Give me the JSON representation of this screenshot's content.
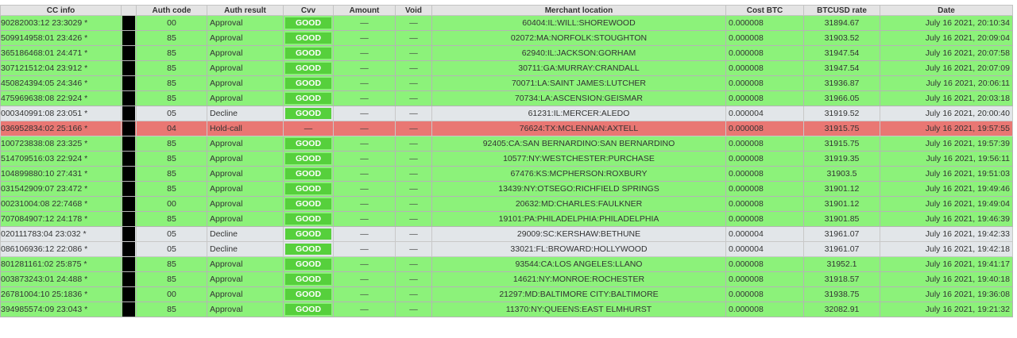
{
  "headers": {
    "cc_info": "CC info",
    "mask": "",
    "auth_code": "Auth code",
    "auth_result": "Auth result",
    "cvv": "Cvv",
    "amount": "Amount",
    "void": "Void",
    "merchant_location": "Merchant location",
    "cost_btc": "Cost BTC",
    "btcusd_rate": "BTCUSD rate",
    "date": "Date"
  },
  "status_colors": {
    "approval": "#8cf27a",
    "decline": "#e2e6e9",
    "holdcall": "#e97773",
    "good_badge": "#56d03c"
  },
  "rows": [
    {
      "status": "approval",
      "cc": "90282003:12 23:3029 *",
      "auth_code": "00",
      "auth_result": "Approval",
      "cvv": "GOOD",
      "amount": "—",
      "void": "—",
      "location": "60404:IL:WILL:SHOREWOOD",
      "cost": "0.000008",
      "rate": "31894.67",
      "date": "July 16 2021, 20:10:34"
    },
    {
      "status": "approval",
      "cc": "509914958:01 23:426 *",
      "auth_code": "85",
      "auth_result": "Approval",
      "cvv": "GOOD",
      "amount": "—",
      "void": "—",
      "location": "02072:MA:NORFOLK:STOUGHTON",
      "cost": "0.000008",
      "rate": "31903.52",
      "date": "July 16 2021, 20:09:04"
    },
    {
      "status": "approval",
      "cc": "365186468:01 24:471 *",
      "auth_code": "85",
      "auth_result": "Approval",
      "cvv": "GOOD",
      "amount": "—",
      "void": "—",
      "location": "62940:IL:JACKSON:GORHAM",
      "cost": "0.000008",
      "rate": "31947.54",
      "date": "July 16 2021, 20:07:58"
    },
    {
      "status": "approval",
      "cc": "307121512:04 23:912 *",
      "auth_code": "85",
      "auth_result": "Approval",
      "cvv": "GOOD",
      "amount": "—",
      "void": "—",
      "location": "30711:GA:MURRAY:CRANDALL",
      "cost": "0.000008",
      "rate": "31947.54",
      "date": "July 16 2021, 20:07:09"
    },
    {
      "status": "approval",
      "cc": "450824394:05 24:346 *",
      "auth_code": "85",
      "auth_result": "Approval",
      "cvv": "GOOD",
      "amount": "—",
      "void": "—",
      "location": "70071:LA:SAINT JAMES:LUTCHER",
      "cost": "0.000008",
      "rate": "31936.87",
      "date": "July 16 2021, 20:06:11"
    },
    {
      "status": "approval",
      "cc": "475969638:08 22:924 *",
      "auth_code": "85",
      "auth_result": "Approval",
      "cvv": "GOOD",
      "amount": "—",
      "void": "—",
      "location": "70734:LA:ASCENSION:GEISMAR",
      "cost": "0.000008",
      "rate": "31966.05",
      "date": "July 16 2021, 20:03:18"
    },
    {
      "status": "decline",
      "cc": "000340991:08 23:051 *",
      "auth_code": "05",
      "auth_result": "Decline",
      "cvv": "GOOD",
      "amount": "—",
      "void": "—",
      "location": "61231:IL:MERCER:ALEDO",
      "cost": "0.000004",
      "rate": "31919.52",
      "date": "July 16 2021, 20:00:40"
    },
    {
      "status": "holdcall",
      "cc": "036952834:02 25:166 *",
      "auth_code": "04",
      "auth_result": "Hold-call",
      "cvv": "—",
      "amount": "—",
      "void": "—",
      "location": "76624:TX:MCLENNAN:AXTELL",
      "cost": "0.000008",
      "rate": "31915.75",
      "date": "July 16 2021, 19:57:55"
    },
    {
      "status": "approval",
      "cc": "100723838:08 23:325 *",
      "auth_code": "85",
      "auth_result": "Approval",
      "cvv": "GOOD",
      "amount": "—",
      "void": "—",
      "location": "92405:CA:SAN BERNARDINO:SAN BERNARDINO",
      "cost": "0.000008",
      "rate": "31915.75",
      "date": "July 16 2021, 19:57:39"
    },
    {
      "status": "approval",
      "cc": "514709516:03 22:924 *",
      "auth_code": "85",
      "auth_result": "Approval",
      "cvv": "GOOD",
      "amount": "—",
      "void": "—",
      "location": "10577:NY:WESTCHESTER:PURCHASE",
      "cost": "0.000008",
      "rate": "31919.35",
      "date": "July 16 2021, 19:56:11"
    },
    {
      "status": "approval",
      "cc": "104899880:10 27:431 *",
      "auth_code": "85",
      "auth_result": "Approval",
      "cvv": "GOOD",
      "amount": "—",
      "void": "—",
      "location": "67476:KS:MCPHERSON:ROXBURY",
      "cost": "0.000008",
      "rate": "31903.5",
      "date": "July 16 2021, 19:51:03"
    },
    {
      "status": "approval",
      "cc": "031542909:07 23:472 *",
      "auth_code": "85",
      "auth_result": "Approval",
      "cvv": "GOOD",
      "amount": "—",
      "void": "—",
      "location": "13439:NY:OTSEGO:RICHFIELD SPRINGS",
      "cost": "0.000008",
      "rate": "31901.12",
      "date": "July 16 2021, 19:49:46"
    },
    {
      "status": "approval",
      "cc": "00231004:08 22:7468 *",
      "auth_code": "00",
      "auth_result": "Approval",
      "cvv": "GOOD",
      "amount": "—",
      "void": "—",
      "location": "20632:MD:CHARLES:FAULKNER",
      "cost": "0.000008",
      "rate": "31901.12",
      "date": "July 16 2021, 19:49:04"
    },
    {
      "status": "approval",
      "cc": "707084907:12 24:178 *",
      "auth_code": "85",
      "auth_result": "Approval",
      "cvv": "GOOD",
      "amount": "—",
      "void": "—",
      "location": "19101:PA:PHILADELPHIA:PHILADELPHIA",
      "cost": "0.000008",
      "rate": "31901.85",
      "date": "July 16 2021, 19:46:39"
    },
    {
      "status": "decline",
      "cc": "020111783:04 23:032 *",
      "auth_code": "05",
      "auth_result": "Decline",
      "cvv": "GOOD",
      "amount": "—",
      "void": "—",
      "location": "29009:SC:KERSHAW:BETHUNE",
      "cost": "0.000004",
      "rate": "31961.07",
      "date": "July 16 2021, 19:42:33"
    },
    {
      "status": "decline",
      "cc": "086106936:12 22:086 *",
      "auth_code": "05",
      "auth_result": "Decline",
      "cvv": "GOOD",
      "amount": "—",
      "void": "—",
      "location": "33021:FL:BROWARD:HOLLYWOOD",
      "cost": "0.000004",
      "rate": "31961.07",
      "date": "July 16 2021, 19:42:18"
    },
    {
      "status": "approval",
      "cc": "801281161:02 25:875 *",
      "auth_code": "85",
      "auth_result": "Approval",
      "cvv": "GOOD",
      "amount": "—",
      "void": "—",
      "location": "93544:CA:LOS ANGELES:LLANO",
      "cost": "0.000008",
      "rate": "31952.1",
      "date": "July 16 2021, 19:41:17"
    },
    {
      "status": "approval",
      "cc": "003873243:01 24:488 *",
      "auth_code": "85",
      "auth_result": "Approval",
      "cvv": "GOOD",
      "amount": "—",
      "void": "—",
      "location": "14621:NY:MONROE:ROCHESTER",
      "cost": "0.000008",
      "rate": "31918.57",
      "date": "July 16 2021, 19:40:18"
    },
    {
      "status": "approval",
      "cc": "26781004:10 25:1836 *",
      "auth_code": "00",
      "auth_result": "Approval",
      "cvv": "GOOD",
      "amount": "—",
      "void": "—",
      "location": "21297:MD:BALTIMORE CITY:BALTIMORE",
      "cost": "0.000008",
      "rate": "31938.75",
      "date": "July 16 2021, 19:36:08"
    },
    {
      "status": "approval",
      "cc": "394985574:09 23:043 *",
      "auth_code": "85",
      "auth_result": "Approval",
      "cvv": "GOOD",
      "amount": "—",
      "void": "—",
      "location": "11370:NY:QUEENS:EAST ELMHURST",
      "cost": "0.000008",
      "rate": "32082.91",
      "date": "July 16 2021, 19:21:32"
    }
  ]
}
